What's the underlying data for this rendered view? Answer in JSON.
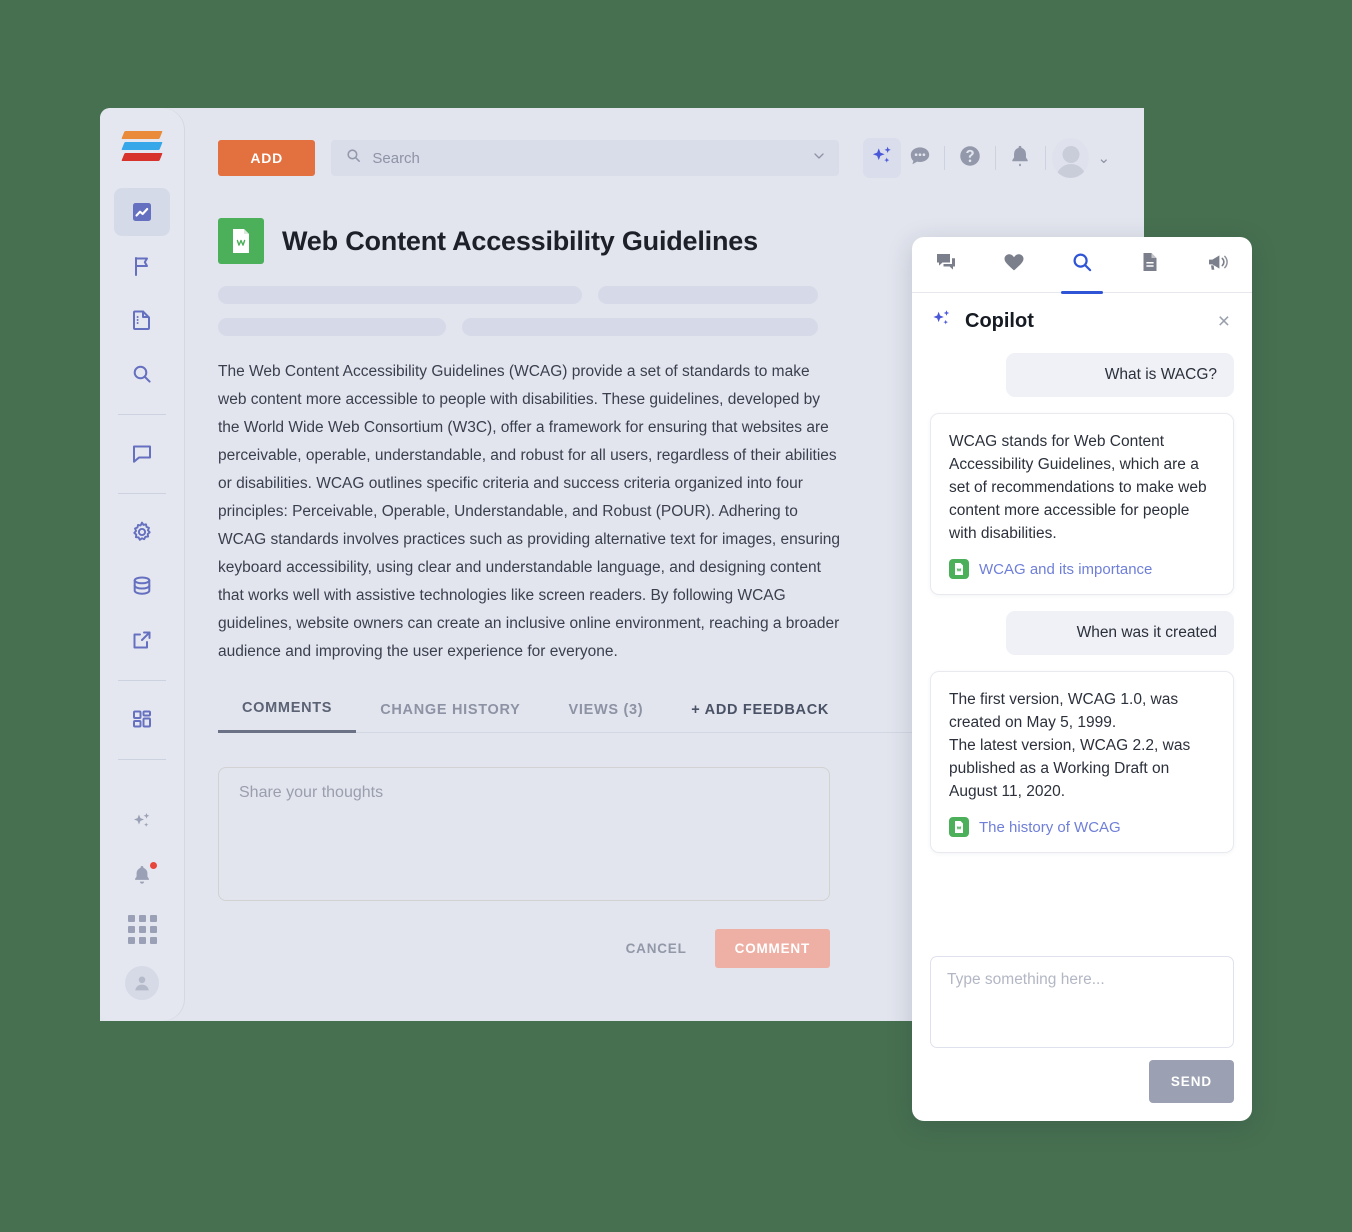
{
  "theme": {
    "page_background": "#477050",
    "accent_orange": "#e3703f",
    "accent_blue": "#4a57d8",
    "doc_green": "#4caf5a",
    "comment_btn": "#eeafa4",
    "send_btn": "#9ba0b2"
  },
  "sidebar": {
    "logo_name": "app-logo",
    "items": [
      {
        "name": "sidebar-item-dashboard",
        "icon": "chart-line-icon",
        "active": true
      },
      {
        "name": "sidebar-item-flag",
        "icon": "flag-icon",
        "active": false
      },
      {
        "name": "sidebar-item-documents",
        "icon": "document-icon",
        "active": false
      },
      {
        "name": "sidebar-item-search",
        "icon": "search-icon",
        "active": false
      },
      {
        "name": "sidebar-item-chat",
        "icon": "chat-bubble-icon",
        "active": false
      },
      {
        "name": "sidebar-item-settings",
        "icon": "gear-icon",
        "active": false
      },
      {
        "name": "sidebar-item-database",
        "icon": "database-icon",
        "active": false
      },
      {
        "name": "sidebar-item-external-link",
        "icon": "external-link-icon",
        "active": false
      },
      {
        "name": "sidebar-item-apps",
        "icon": "grid-blocks-icon",
        "active": false
      }
    ],
    "bottom_items": [
      {
        "name": "sidebar-item-copilot",
        "icon": "sparkles-icon"
      },
      {
        "name": "sidebar-item-notifications",
        "icon": "bell-icon",
        "badge": true
      },
      {
        "name": "sidebar-item-app-grid",
        "icon": "dots-grid-icon"
      },
      {
        "name": "sidebar-item-profile",
        "icon": "avatar-icon"
      }
    ]
  },
  "topbar": {
    "add_label": "ADD",
    "search_placeholder": "Search",
    "search_value": "",
    "icons": [
      {
        "name": "copilot-sparkles-icon",
        "label": "Copilot"
      },
      {
        "name": "chat-bubble-icon",
        "label": "Chat"
      },
      {
        "name": "help-icon",
        "label": "Help"
      },
      {
        "name": "bell-icon",
        "label": "Notifications"
      }
    ],
    "avatar_caret": "⌄"
  },
  "document": {
    "title": "Web Content Accessibility Guidelines",
    "badge_icon": "document-w-icon",
    "body": "The Web Content Accessibility Guidelines (WCAG) provide a set of standards to make web content more accessible to people with disabilities. These guidelines, developed by the World Wide Web Consortium (W3C), offer a framework for ensuring that websites are perceivable, operable, understandable, and robust for all users, regardless of their abilities or disabilities. WCAG outlines specific criteria and success criteria organized into four principles: Perceivable, Operable, Understandable, and Robust (POUR). Adhering to WCAG standards involves practices such as providing alternative text for images, ensuring keyboard accessibility, using clear and understandable language, and designing content that works well with assistive technologies like screen readers. By following WCAG guidelines, website owners can create an inclusive online environment, reaching a broader audience and improving the user experience for everyone."
  },
  "tabs": [
    {
      "label": "COMMENTS",
      "active": true
    },
    {
      "label": "CHANGE HISTORY",
      "active": false
    },
    {
      "label": "VIEWS (3)",
      "active": false
    },
    {
      "label": "+ ADD FEEDBACK",
      "active": false,
      "accent": true
    }
  ],
  "comment_form": {
    "placeholder": "Share your thoughts",
    "value": "",
    "cancel_label": "CANCEL",
    "submit_label": "COMMENT"
  },
  "copilot": {
    "tabs": [
      {
        "name": "tab-conversations",
        "icon": "chat-bubbles-icon",
        "active": false
      },
      {
        "name": "tab-favorites",
        "icon": "heart-icon",
        "active": false
      },
      {
        "name": "tab-search",
        "icon": "search-icon",
        "active": true
      },
      {
        "name": "tab-documents",
        "icon": "document-icon",
        "active": false
      },
      {
        "name": "tab-announcements",
        "icon": "megaphone-icon",
        "active": false
      }
    ],
    "title": "Copilot",
    "title_icon": "sparkles-icon",
    "close_label": "×",
    "messages": [
      {
        "role": "user",
        "text": "What is WACG?"
      },
      {
        "role": "bot",
        "text": "WCAG stands for Web Content Accessibility Guidelines, which are a set of recommendations to make web content more accessible for people with disabilities.",
        "source_label": "WCAG and its importance",
        "source_icon": "document-badge-icon"
      },
      {
        "role": "user",
        "text": "When was it created"
      },
      {
        "role": "bot",
        "text": "The first version, WCAG 1.0, was created on May 5, 1999.\nThe latest version, WCAG 2.2, was published as a Working Draft on August 11, 2020.",
        "source_label": "The history of WCAG",
        "source_icon": "document-badge-icon"
      }
    ],
    "input_placeholder": "Type something here...",
    "input_value": "",
    "send_label": "SEND"
  }
}
